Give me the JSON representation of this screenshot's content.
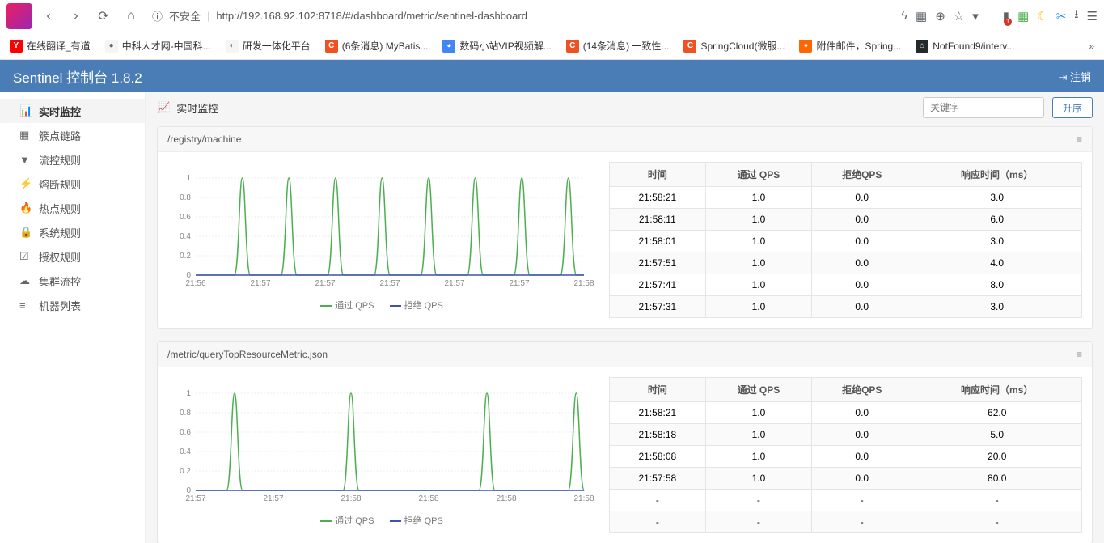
{
  "browser": {
    "insecure_label": "不安全",
    "url": "http://192.168.92.102:8718/#/dashboard/metric/sentinel-dashboard"
  },
  "bookmarks": [
    {
      "icon": "Y",
      "cls": "bm-y",
      "label": "在线翻译_有道"
    },
    {
      "icon": "●",
      "cls": "bm-g",
      "label": "中科人才网-中国科..."
    },
    {
      "icon": "◐",
      "cls": "bm-g",
      "label": "研发一体化平台"
    },
    {
      "icon": "C",
      "cls": "bm-c",
      "label": "(6条消息) MyBatis..."
    },
    {
      "icon": "◕",
      "cls": "bm-b",
      "label": "数码小站VIP视频解..."
    },
    {
      "icon": "C",
      "cls": "bm-c",
      "label": "(14条消息) 一致性..."
    },
    {
      "icon": "C",
      "cls": "bm-c",
      "label": "SpringCloud(微服..."
    },
    {
      "icon": "♦",
      "cls": "bm-o",
      "label": "附件邮件，Spring..."
    },
    {
      "icon": "⌂",
      "cls": "bm-gh",
      "label": "NotFound9/interv..."
    }
  ],
  "app": {
    "title": "Sentinel 控制台 1.8.2",
    "logout": "注销"
  },
  "sidebar": [
    {
      "icon": "📊",
      "label": "实时监控",
      "active": true
    },
    {
      "icon": "▦",
      "label": "簇点链路"
    },
    {
      "icon": "▼",
      "label": "流控规则"
    },
    {
      "icon": "⚡",
      "label": "熔断规则"
    },
    {
      "icon": "🔥",
      "label": "热点规则"
    },
    {
      "icon": "🔒",
      "label": "系统规则"
    },
    {
      "icon": "☑",
      "label": "授权规则"
    },
    {
      "icon": "☁",
      "label": "集群流控"
    },
    {
      "icon": "≡",
      "label": "机器列表"
    }
  ],
  "page": {
    "title": "实时监控",
    "keyword_placeholder": "关键字",
    "sort_label": "升序"
  },
  "legend": {
    "pass": "通过 QPS",
    "block": "拒绝 QPS"
  },
  "tbl_headers": {
    "time": "时间",
    "pass": "通过 QPS",
    "block": "拒绝QPS",
    "rt": "响应时间（ms）"
  },
  "panels": [
    {
      "title": "/registry/machine",
      "chart_data": {
        "type": "line",
        "ylim": [
          0,
          1
        ],
        "yticks": [
          0,
          0.2,
          0.4,
          0.6,
          0.8,
          1
        ],
        "xticks": [
          "21:56",
          "21:57",
          "21:57",
          "21:57",
          "21:57",
          "21:57",
          "21:58"
        ],
        "series": [
          {
            "name": "通过 QPS",
            "color": "#4caf50",
            "peaks": [
              0.12,
              0.24,
              0.36,
              0.48,
              0.6,
              0.72,
              0.84,
              0.96
            ]
          },
          {
            "name": "拒绝 QPS",
            "color": "#3f51b5",
            "flat": 0
          }
        ]
      },
      "rows": [
        {
          "t": "21:58:21",
          "p": "1.0",
          "b": "0.0",
          "r": "3.0"
        },
        {
          "t": "21:58:11",
          "p": "1.0",
          "b": "0.0",
          "r": "6.0"
        },
        {
          "t": "21:58:01",
          "p": "1.0",
          "b": "0.0",
          "r": "3.0"
        },
        {
          "t": "21:57:51",
          "p": "1.0",
          "b": "0.0",
          "r": "4.0"
        },
        {
          "t": "21:57:41",
          "p": "1.0",
          "b": "0.0",
          "r": "8.0"
        },
        {
          "t": "21:57:31",
          "p": "1.0",
          "b": "0.0",
          "r": "3.0"
        }
      ]
    },
    {
      "title": "/metric/queryTopResourceMetric.json",
      "chart_data": {
        "type": "line",
        "ylim": [
          0,
          1
        ],
        "yticks": [
          0,
          0.2,
          0.4,
          0.6,
          0.8,
          1
        ],
        "xticks": [
          "21:57",
          "21:57",
          "21:58",
          "21:58",
          "21:58",
          "21:58"
        ],
        "series": [
          {
            "name": "通过 QPS",
            "color": "#4caf50",
            "peaks": [
              0.1,
              0.4,
              0.75,
              0.98
            ]
          },
          {
            "name": "拒绝 QPS",
            "color": "#3f51b5",
            "flat": 0
          }
        ]
      },
      "rows": [
        {
          "t": "21:58:21",
          "p": "1.0",
          "b": "0.0",
          "r": "62.0"
        },
        {
          "t": "21:58:18",
          "p": "1.0",
          "b": "0.0",
          "r": "5.0"
        },
        {
          "t": "21:58:08",
          "p": "1.0",
          "b": "0.0",
          "r": "20.0"
        },
        {
          "t": "21:57:58",
          "p": "1.0",
          "b": "0.0",
          "r": "80.0"
        },
        {
          "t": "-",
          "p": "-",
          "b": "-",
          "r": "-"
        },
        {
          "t": "-",
          "p": "-",
          "b": "-",
          "r": "-"
        }
      ]
    }
  ]
}
